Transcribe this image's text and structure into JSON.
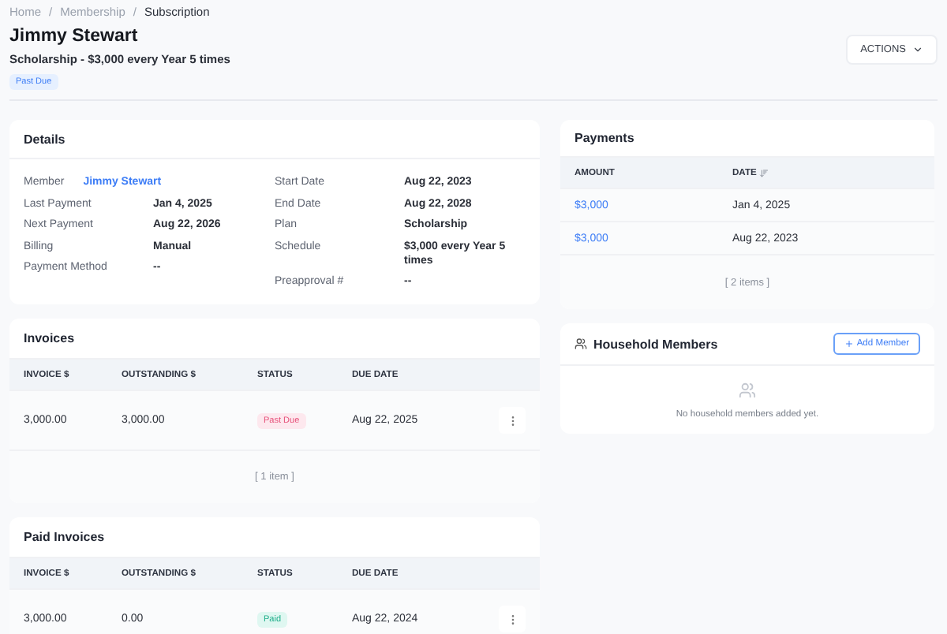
{
  "breadcrumb_separator": "/",
  "breadcrumb": [
    {
      "label": "Home",
      "current": false
    },
    {
      "label": "Membership",
      "current": false
    },
    {
      "label": "Subscription",
      "current": true
    }
  ],
  "title": "Jimmy Stewart",
  "subtitle": "Scholarship - $3,000 every Year 5 times",
  "status_badge": {
    "label": "Past Due",
    "kind": "past_due"
  },
  "actions_button": {
    "label": "ACTIONS"
  },
  "details": {
    "title": "Details",
    "left": [
      {
        "label": "Member",
        "value": "Jimmy Stewart",
        "kind": "link"
      },
      {
        "label": "Last Payment",
        "value": "Jan 4, 2025",
        "kind": "text"
      },
      {
        "label": "Next Payment",
        "value": "Aug 22, 2026",
        "kind": "text"
      },
      {
        "label": "Billing",
        "value": "Manual",
        "kind": "text"
      },
      {
        "label": "Payment Method",
        "value": "--",
        "kind": "text"
      }
    ],
    "right": [
      {
        "label": "Start Date",
        "value": "Aug 22, 2023",
        "kind": "text"
      },
      {
        "label": "End Date",
        "value": "Aug 22, 2028",
        "kind": "text"
      },
      {
        "label": "Plan",
        "value": "Scholarship",
        "kind": "text"
      },
      {
        "label": "Schedule",
        "value": "$3,000 every Year 5 times",
        "kind": "text"
      },
      {
        "label": "Preapproval #",
        "value": "--",
        "kind": "text"
      }
    ]
  },
  "invoices": {
    "title": "Invoices",
    "columns": [
      "INVOICE $",
      "OUTSTANDING $",
      "STATUS",
      "DUE DATE"
    ],
    "rows": [
      {
        "invoice": "3,000.00",
        "outstanding": "3,000.00",
        "status": {
          "label": "Past Due",
          "kind": "past_due"
        },
        "due_date": "Aug 22, 2025"
      }
    ],
    "footer": "[ 1 item ]"
  },
  "paid_invoices": {
    "title": "Paid Invoices",
    "columns": [
      "INVOICE $",
      "OUTSTANDING $",
      "STATUS",
      "DUE DATE"
    ],
    "rows": [
      {
        "invoice": "3,000.00",
        "outstanding": "0.00",
        "status": {
          "label": "Paid",
          "kind": "paid"
        },
        "due_date": "Aug 22, 2024"
      }
    ]
  },
  "payments": {
    "title": "Payments",
    "columns": [
      {
        "label": "AMOUNT",
        "sorted": false
      },
      {
        "label": "DATE",
        "sorted": true
      }
    ],
    "rows": [
      {
        "amount": "$3,000",
        "date": "Jan 4, 2025"
      },
      {
        "amount": "$3,000",
        "date": "Aug 22, 2023"
      }
    ],
    "footer": "[ 2 items ]"
  },
  "household": {
    "title": "Household Members",
    "add_button": "Add Member",
    "empty_text": "No household members added yet."
  }
}
